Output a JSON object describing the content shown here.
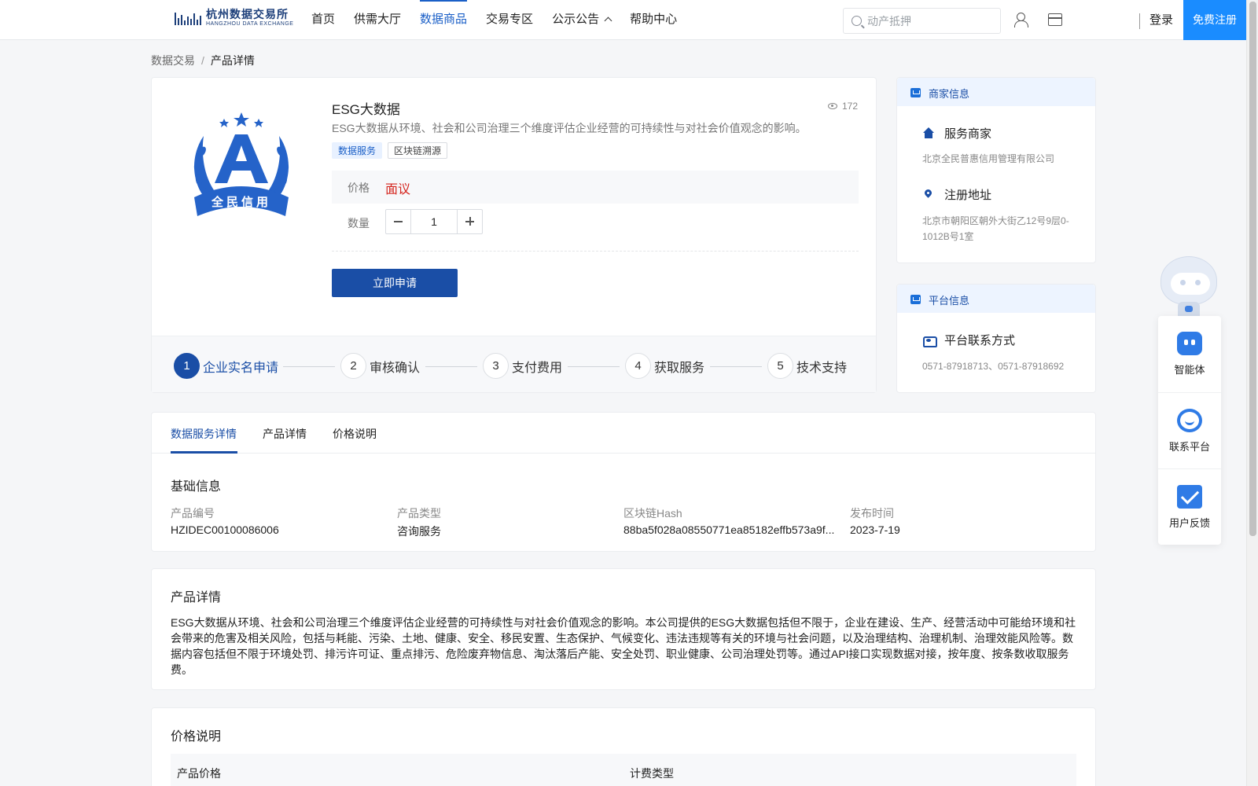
{
  "header": {
    "logo_cn": "杭州数据交易所",
    "logo_en": "HANGZHOU DATA EXCHANGE",
    "nav": [
      {
        "label": "首页"
      },
      {
        "label": "供需大厅"
      },
      {
        "label": "数据商品",
        "active": true
      },
      {
        "label": "交易专区"
      },
      {
        "label": "公示公告"
      },
      {
        "label": "帮助中心"
      }
    ],
    "search_placeholder": "动产抵押",
    "login": "登录",
    "register": "免费注册"
  },
  "breadcrumb": {
    "root": "数据交易",
    "separator": "/",
    "current": "产品详情"
  },
  "product": {
    "badge_letter": "A",
    "badge_text": "全民信用",
    "title": "ESG大数据",
    "views": "172",
    "description": "ESG大数据从环境、社会和公司治理三个维度评估企业经营的可持续性与对社会价值观念的影响。",
    "tags": [
      "数据服务",
      "区块链溯源"
    ],
    "price_label": "价格",
    "price_value": "面议",
    "quantity_label": "数量",
    "quantity": "1",
    "apply_button": "立即申请",
    "steps": [
      {
        "num": "1",
        "label": "企业实名申请"
      },
      {
        "num": "2",
        "label": "审核确认"
      },
      {
        "num": "3",
        "label": "支付费用"
      },
      {
        "num": "4",
        "label": "获取服务"
      },
      {
        "num": "5",
        "label": "技术支持"
      }
    ]
  },
  "merchant": {
    "header": "商家信息",
    "service_title": "服务商家",
    "service_value": "北京全民普惠信用管理有限公司",
    "address_title": "注册地址",
    "address_value": "北京市朝阳区朝外大街乙12号9层0-1012B号1室"
  },
  "platform": {
    "header": "平台信息",
    "contact_title": "平台联系方式",
    "contact_value": "0571-87918713、0571-87918692"
  },
  "details": {
    "tabs": [
      "数据服务详情",
      "产品详情",
      "价格说明"
    ],
    "basic_title": "基础信息",
    "fields": [
      {
        "label": "产品编号",
        "value": "HZIDEC00100086006"
      },
      {
        "label": "产品类型",
        "value": "咨询服务"
      },
      {
        "label": "区块链Hash",
        "value": "88ba5f028a08550771ea85182effb573a9f..."
      },
      {
        "label": "发布时间",
        "value": "2023-7-19"
      }
    ]
  },
  "product_detail": {
    "title": "产品详情",
    "text": "ESG大数据从环境、社会和公司治理三个维度评估企业经营的可持续性与对社会价值观念的影响。本公司提供的ESG大数据包括但不限于，企业在建设、生产、经营活动中可能给环境和社会带来的危害及相关风险，包括与耗能、污染、土地、健康、安全、移民安置、生态保护、气候变化、违法违规等有关的环境与社会问题，以及治理结构、治理机制、治理效能风险等。数据内容包括但不限于环境处罚、排污许可证、重点排污、危险废弃物信息、淘汰落后产能、安全处罚、职业健康、公司治理处罚等。通过API接口实现数据对接，按年度、按条数收取服务费。"
  },
  "price_section": {
    "title": "价格说明",
    "col1": "产品价格",
    "col2": "计费类型"
  },
  "float_panel": {
    "items": [
      {
        "label": "智能体",
        "icon": "agent-icon"
      },
      {
        "label": "联系平台",
        "icon": "headset-icon"
      },
      {
        "label": "用户反馈",
        "icon": "feedback-icon"
      }
    ]
  },
  "colors": {
    "primary": "#1a4ea6",
    "accent": "#1a8cff",
    "price": "#d4231c"
  }
}
